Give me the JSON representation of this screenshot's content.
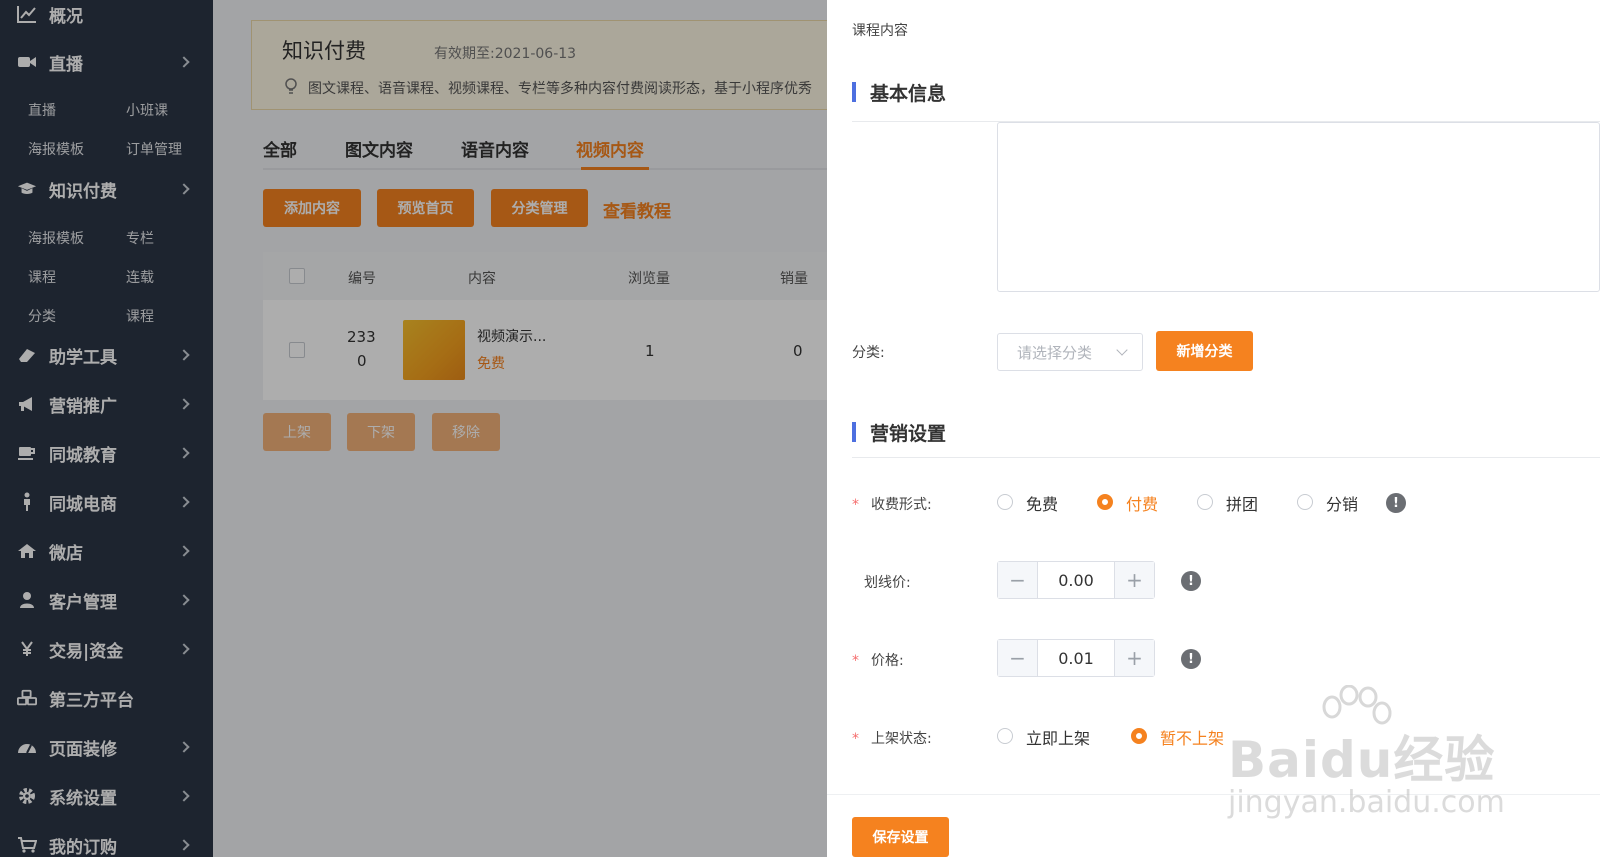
{
  "sidebar": {
    "items": [
      {
        "label": "概况",
        "icon": "chart-line-icon",
        "arrow": false
      },
      {
        "label": "直播",
        "icon": "video-camera-icon",
        "arrow": true
      },
      {
        "label": "知识付费",
        "icon": "graduation-cap-icon",
        "arrow": true
      },
      {
        "label": "助学工具",
        "icon": "eraser-icon",
        "arrow": true
      },
      {
        "label": "营销推广",
        "icon": "bullhorn-icon",
        "arrow": true
      },
      {
        "label": "同城教育",
        "icon": "coffee-cup-icon",
        "arrow": true
      },
      {
        "label": "同城电商",
        "icon": "person-icon",
        "arrow": true
      },
      {
        "label": "微店",
        "icon": "home-icon",
        "arrow": true
      },
      {
        "label": "客户管理",
        "icon": "user-icon",
        "arrow": true
      },
      {
        "label": "交易|资金",
        "icon": "yen-icon",
        "arrow": true
      },
      {
        "label": "第三方平台",
        "icon": "cubes-icon",
        "arrow": false
      },
      {
        "label": "页面装修",
        "icon": "dashboard-icon",
        "arrow": true
      },
      {
        "label": "系统设置",
        "icon": "gear-icon",
        "arrow": true
      },
      {
        "label": "我的订购",
        "icon": "cart-icon",
        "arrow": true
      }
    ],
    "live_sub": [
      "直播",
      "小班课",
      "海报模板",
      "订单管理"
    ],
    "knowledge_sub": [
      "海报模板",
      "专栏",
      "课程",
      "连载",
      "分类",
      "课程"
    ]
  },
  "main": {
    "notice_title": "知识付费",
    "notice_expiry": "有效期至:2021-06-13",
    "notice_desc": "图文课程、语音课程、视频课程、专栏等多种内容付费阅读形态，基于小程序优秀",
    "tabs": [
      "全部",
      "图文内容",
      "语音内容",
      "视频内容"
    ],
    "active_tab": "视频内容",
    "buttons": [
      "添加内容",
      "预览首页",
      "分类管理"
    ],
    "tutorial_link": "查看教程",
    "table_headers": [
      "编号",
      "内容",
      "浏览量",
      "销量"
    ],
    "row": {
      "id_line1": "233",
      "id_line2": "0",
      "title": "视频演示...",
      "price_tag": "免费",
      "views": "1",
      "sales": "0"
    },
    "bulk_actions": [
      "上架",
      "下架",
      "移除"
    ]
  },
  "drawer": {
    "title": "课程内容",
    "section_basic": "基本信息",
    "category_label": "分类:",
    "category_placeholder": "请选择分类",
    "add_category_button": "新增分类",
    "section_marketing": "营销设置",
    "charge_label": "收费形式:",
    "charge_options": [
      "免费",
      "付费",
      "拼团",
      "分销"
    ],
    "charge_selected": "付费",
    "strike_price_label": "划线价:",
    "strike_price_value": "0.00",
    "price_label": "价格:",
    "price_value": "0.01",
    "listing_label": "上架状态:",
    "listing_options": [
      "立即上架",
      "暂不上架"
    ],
    "listing_selected": "暂不上架",
    "required_mark": "*",
    "info_mark": "!",
    "minus": "−",
    "plus": "+",
    "save_button": "保存设置"
  },
  "watermark": {
    "brand": "Baidu经验",
    "url": "jingyan.baidu.com"
  },
  "colors": {
    "sidebar_bg": "#2b3546",
    "accent_orange": "#f5821f",
    "section_bar": "#4d6fe0",
    "required_red": "#f56c6c"
  }
}
